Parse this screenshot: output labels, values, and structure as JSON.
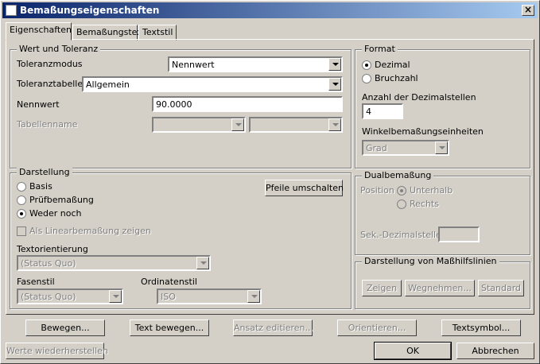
{
  "window": {
    "title": "Bemaßungseigenschaften",
    "close_label": "×"
  },
  "tabs": [
    {
      "label": "Eigenschaften"
    },
    {
      "label": "Bemaßungstext"
    },
    {
      "label": "Textstil"
    }
  ],
  "wert": {
    "legend": "Wert und Toleranz",
    "toleranzmodus_label": "Toleranzmodus",
    "toleranzmodus_value": "Nennwert",
    "toleranztabelle_label": "Toleranztabelle",
    "toleranztabelle_value": "Allgemein",
    "nennwert_label": "Nennwert",
    "nennwert_value": "90.0000",
    "tabellenname_label": "Tabellenname",
    "tabellenname_value1": "",
    "tabellenname_value2": ""
  },
  "format": {
    "legend": "Format",
    "dezimal_label": "Dezimal",
    "bruchzahl_label": "Bruchzahl",
    "dezimalstellen_label": "Anzahl der Dezimalstellen",
    "dezimalstellen_value": "4",
    "winkel_label": "Winkelbemaßungseinheiten",
    "winkel_value": "Grad"
  },
  "darstellung": {
    "legend": "Darstellung",
    "basis_label": "Basis",
    "pruef_label": "Prüfbemaßung",
    "weder_label": "Weder noch",
    "pfeile_button": "Pfeile umschalten",
    "linear_label": "Als Linearbemaßung zeigen",
    "textorientierung_label": "Textorientierung",
    "textorientierung_value": "(Status Quo)",
    "fasenstil_label": "Fasenstil",
    "fasenstil_value": "(Status Quo)",
    "ordinatenstil_label": "Ordinatenstil",
    "ordinatenstil_value": "ISO"
  },
  "dual": {
    "legend": "Dualbemaßung",
    "position_label": "Position",
    "unterhalb_label": "Unterhalb",
    "rechts_label": "Rechts",
    "sek_label": "Sek.-Dezimalstellen",
    "sek_value": ""
  },
  "hilfslinien": {
    "legend": "Darstellung von Maßhilfslinien",
    "zeigen": "Zeigen",
    "wegnehmen": "Wegnehmen...",
    "standard": "Standard"
  },
  "actions": {
    "bewegen": "Bewegen...",
    "text_bewegen": "Text bewegen...",
    "ansatz": "Ansatz editieren...",
    "orientieren": "Orientieren...",
    "textsymbol": "Textsymbol...",
    "werte": "Werte wiederherstellen",
    "ok": "OK",
    "abbrechen": "Abbrechen"
  }
}
